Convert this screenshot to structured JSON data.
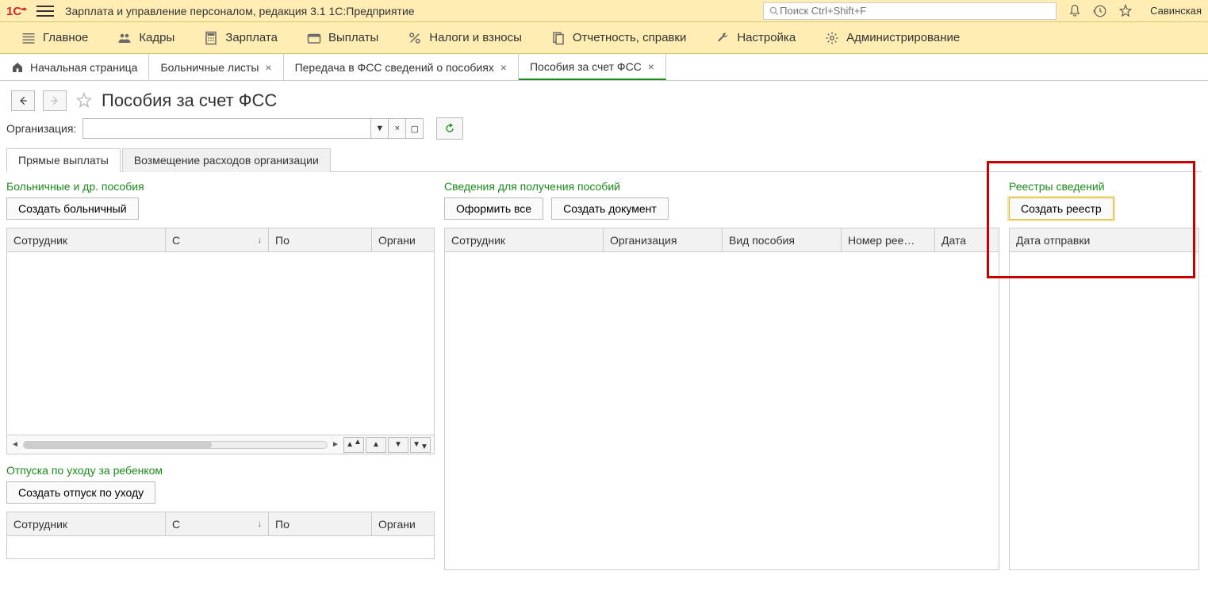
{
  "header": {
    "app_title": "Зарплата и управление персоналом, редакция 3.1 1С:Предприятие",
    "search_placeholder": "Поиск Ctrl+Shift+F",
    "user": "Савинская"
  },
  "main_menu": [
    {
      "label": "Главное"
    },
    {
      "label": "Кадры"
    },
    {
      "label": "Зарплата"
    },
    {
      "label": "Выплаты"
    },
    {
      "label": "Налоги и взносы"
    },
    {
      "label": "Отчетность, справки"
    },
    {
      "label": "Настройка"
    },
    {
      "label": "Администрирование"
    }
  ],
  "tabs": {
    "home": "Начальная страница",
    "items": [
      {
        "label": "Больничные листы"
      },
      {
        "label": "Передача в ФСС сведений о пособиях"
      },
      {
        "label": "Пособия за счет ФСС",
        "active": true
      }
    ]
  },
  "page": {
    "title": "Пособия за счет ФСС",
    "org_label": "Организация:"
  },
  "inner_tabs": [
    {
      "label": "Прямые выплаты",
      "active": true
    },
    {
      "label": "Возмещение расходов организации"
    }
  ],
  "left": {
    "section1_title": "Больничные и др. пособия",
    "create_btn": "Создать больничный",
    "cols": [
      "Сотрудник",
      "С",
      "По",
      "Органи"
    ],
    "section2_title": "Отпуска по уходу за ребенком",
    "create_btn2": "Создать отпуск по уходу",
    "cols2": [
      "Сотрудник",
      "С",
      "По",
      "Органи"
    ]
  },
  "mid": {
    "title": "Сведения для получения пособий",
    "btn_all": "Оформить все",
    "btn_create": "Создать документ",
    "cols": [
      "Сотрудник",
      "Организация",
      "Вид пособия",
      "Номер рее…",
      "Дата"
    ]
  },
  "right": {
    "title": "Реестры сведений",
    "btn_create": "Создать реестр",
    "cols": [
      "Дата отправки"
    ]
  }
}
